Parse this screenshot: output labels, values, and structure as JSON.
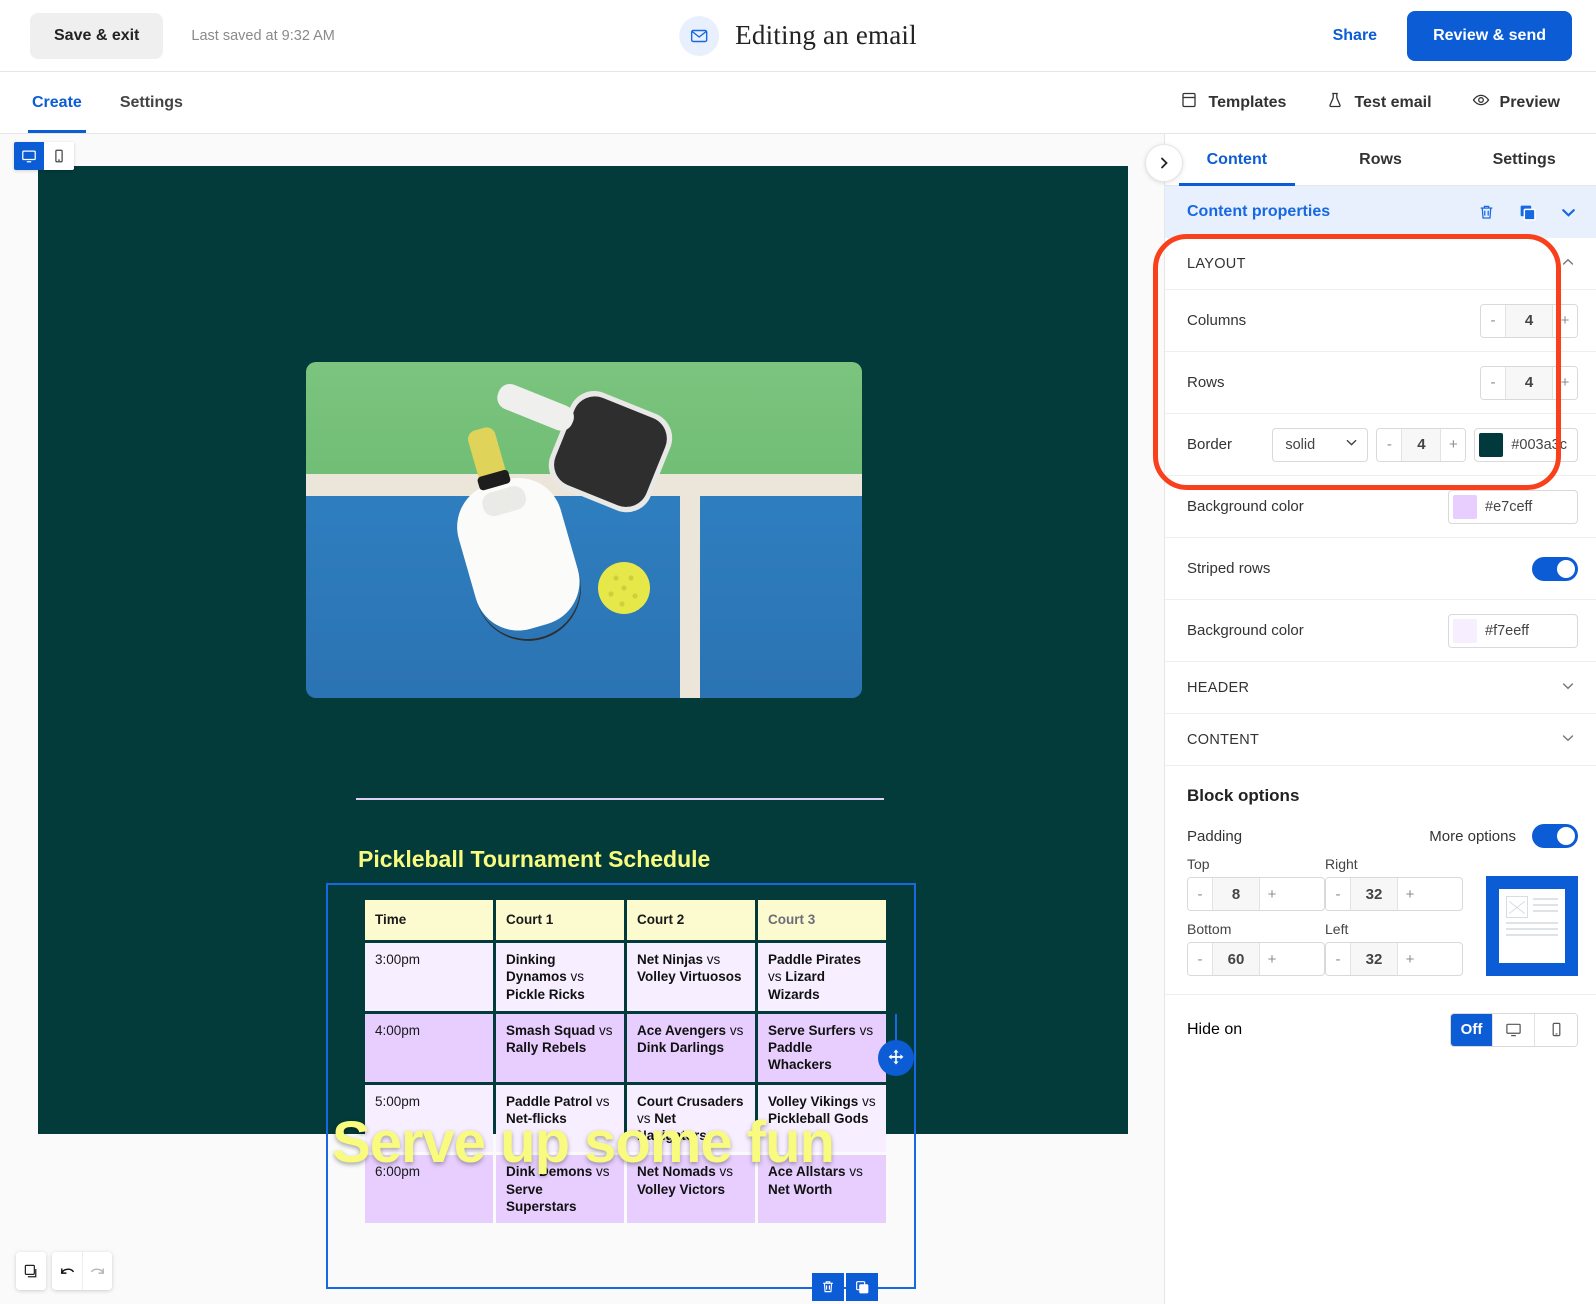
{
  "topbar": {
    "save_exit": "Save & exit",
    "last_saved": "Last saved at 9:32 AM",
    "title": "Editing an email",
    "share": "Share",
    "review_send": "Review & send",
    "mail_icon": "envelope-icon"
  },
  "subbar": {
    "tabs": [
      {
        "label": "Create",
        "active": true
      },
      {
        "label": "Settings",
        "active": false
      }
    ],
    "actions": [
      {
        "label": "Templates",
        "icon": "templates-icon"
      },
      {
        "label": "Test email",
        "icon": "flask-icon"
      },
      {
        "label": "Preview",
        "icon": "eye-icon"
      }
    ]
  },
  "canvas": {
    "device_toggle": [
      {
        "icon": "desktop-icon",
        "active": true
      },
      {
        "icon": "mobile-icon",
        "active": false
      }
    ],
    "email": {
      "background_color": "#023b3a",
      "hero": {
        "alt": "pickleball paddles and ball on court",
        "headline": "Serve up some fun",
        "headline_color": "#f9fb7e"
      },
      "divider_color": "#ded0f5",
      "schedule_title": "Pickleball Tournament Schedule"
    },
    "block_tools": [
      {
        "icon": "trash-icon",
        "name": "delete-block"
      },
      {
        "icon": "duplicate-icon",
        "name": "duplicate-block"
      }
    ],
    "drag_handle_icon": "move-icon"
  },
  "chart_data": {
    "type": "table",
    "title": "Pickleball Tournament Schedule",
    "columns": [
      "Time",
      "Court 1",
      "Court 2",
      "Court 3"
    ],
    "rows": [
      {
        "time": "3:00pm",
        "court1": {
          "team_a": "Dinking Dynamos",
          "vs": "vs",
          "team_b": "Pickle Ricks"
        },
        "court2": {
          "team_a": "Net Ninjas",
          "vs": "vs",
          "team_b": "Volley Virtuosos"
        },
        "court3": {
          "team_a": "Paddle Pirates",
          "vs": "vs",
          "team_b": "Lizard Wizards"
        }
      },
      {
        "time": "4:00pm",
        "court1": {
          "team_a": "Smash Squad",
          "vs": "vs",
          "team_b": "Rally Rebels"
        },
        "court2": {
          "team_a": "Ace Avengers",
          "vs": "vs",
          "team_b": "Dink Darlings"
        },
        "court3": {
          "team_a": "Serve Surfers",
          "vs": "vs",
          "team_b": "Paddle Whackers"
        }
      },
      {
        "time": "5:00pm",
        "court1": {
          "team_a": "Paddle Patrol",
          "vs": "vs",
          "team_b": "Net-flicks"
        },
        "court2": {
          "team_a": "Court Crusaders",
          "vs": "vs",
          "team_b": "Net Navigators"
        },
        "court3": {
          "team_a": "Volley Vikings",
          "vs": "vs",
          "team_b": "Pickleball Gods"
        }
      },
      {
        "time": "6:00pm",
        "court1": {
          "team_a": "Dink Demons",
          "vs": "vs",
          "team_b": "Serve Superstars"
        },
        "court2": {
          "team_a": "Net Nomads",
          "vs": "vs",
          "team_b": "Volley Victors"
        },
        "court3": {
          "team_a": "Ace Allstars",
          "vs": "vs",
          "team_b": "Net Worth"
        }
      }
    ],
    "header_background": "#fbfbcf",
    "row_background": "#f7eeff",
    "stripe_background": "#e7ceff"
  },
  "panel": {
    "collapse_icon": "chevron-right-icon",
    "tabs": [
      {
        "label": "Content",
        "active": true
      },
      {
        "label": "Rows",
        "active": false
      },
      {
        "label": "Settings",
        "active": false
      }
    ],
    "content_properties": {
      "label": "Content properties",
      "icons": [
        "trash-icon",
        "duplicate-icon",
        "chevron-down-icon"
      ]
    },
    "layout": {
      "heading": "LAYOUT",
      "caret": "chevron-up-icon",
      "columns": {
        "label": "Columns",
        "value": "4",
        "minus": "-",
        "plus": "+"
      },
      "rows": {
        "label": "Rows",
        "value": "4",
        "minus": "-",
        "plus": "+"
      },
      "border": {
        "label": "Border",
        "style": "solid",
        "width": "4",
        "minus": "-",
        "plus": "+",
        "color": "#003a3c",
        "color_swatch": "#003a3c"
      },
      "background_color": {
        "label": "Background color",
        "value": "#e7ceff",
        "swatch": "#e7ceff"
      },
      "striped_rows": {
        "label": "Striped rows",
        "on": true
      },
      "striped_background_color": {
        "label": "Background color",
        "value": "#f7eeff",
        "swatch": "#f7eeff"
      }
    },
    "header_section": {
      "heading": "HEADER",
      "caret": "chevron-down-icon"
    },
    "content_section": {
      "heading": "CONTENT",
      "caret": "chevron-down-icon"
    },
    "block_options": {
      "title": "Block options",
      "padding_label": "Padding",
      "more_options_label": "More options",
      "more_options_on": true,
      "padding": {
        "top": {
          "label": "Top",
          "value": "8"
        },
        "right": {
          "label": "Right",
          "value": "32"
        },
        "bottom": {
          "label": "Bottom",
          "value": "60"
        },
        "left": {
          "label": "Left",
          "value": "32"
        }
      },
      "minus": "-",
      "plus": "+"
    },
    "hide_on": {
      "label": "Hide on",
      "options": [
        {
          "label": "Off",
          "icon": "",
          "active": true
        },
        {
          "label": "",
          "icon": "desktop-icon",
          "active": false
        },
        {
          "label": "",
          "icon": "mobile-icon",
          "active": false
        }
      ]
    },
    "highlight_color": "#f9401c"
  },
  "bottom_tools": [
    {
      "icon": "layers-icon",
      "name": "layers-button"
    },
    {
      "icon": "undo-icon",
      "name": "undo-button"
    },
    {
      "icon": "redo-icon",
      "name": "redo-button"
    }
  ]
}
